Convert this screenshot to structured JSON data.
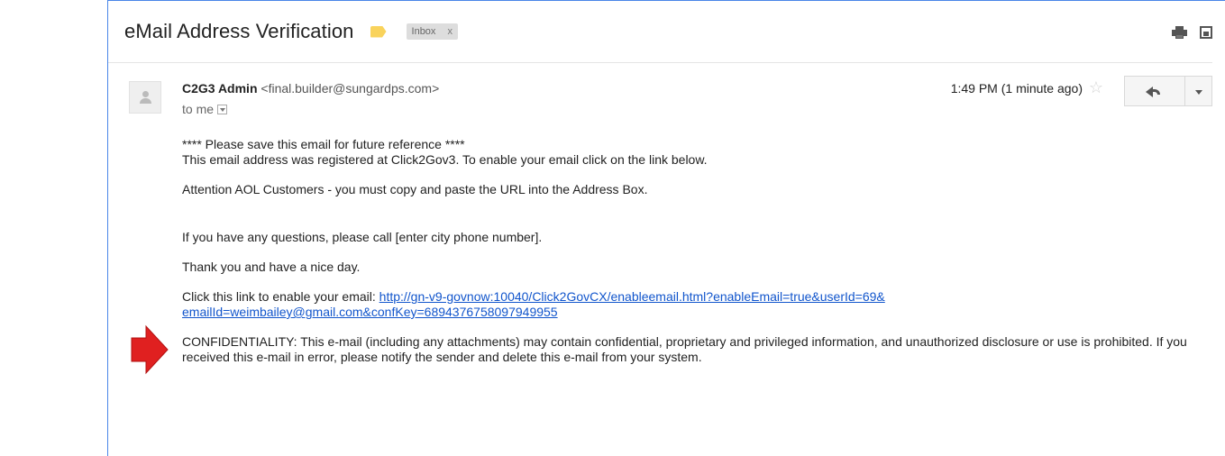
{
  "email": {
    "subject": "eMail Address Verification",
    "label_chip": "Inbox",
    "label_chip_close": "x",
    "sender_name": "C2G3 Admin",
    "sender_email": "<final.builder@sungardps.com>",
    "recipient": "to me",
    "time": "1:49 PM (1 minute ago)",
    "body": {
      "line1": "**** Please save this email for future reference ****",
      "line2": "This email address was registered at Click2Gov3. To enable your email click on the link below.",
      "line3": "Attention AOL Customers - you must copy and paste the URL into the Address Box.",
      "line4": "If you have any questions, please call [enter city phone number].",
      "line5": "Thank you and have a nice day.",
      "link_prefix": "Click this link to enable your email: ",
      "link_line1": "http://gn-v9-govnow:10040/Click2GovCX/enableemail.html?enableEmail=true&userId=69&",
      "link_line2": "emailId=weimbailey@gmail.com&confKey=6894376758097949955",
      "confidentiality": "CONFIDENTIALITY: This e-mail (including any attachments) may contain confidential, proprietary and privileged information, and unauthorized disclosure or use is prohibited. If you received this e-mail in error, please notify the sender and delete this e-mail from your system."
    }
  },
  "icons": {
    "tag": "label-tag-icon",
    "print": "printer-icon",
    "new_window": "new-window-icon",
    "avatar": "avatar-icon",
    "star": "star-icon",
    "reply": "reply-icon",
    "more": "chevron-down-icon",
    "annotation": "red-arrow-icon"
  },
  "colors": {
    "link": "#1155cc",
    "tag": "#f9d35c",
    "annotation_arrow": "#e02020",
    "frame_border": "#4a86e8"
  }
}
